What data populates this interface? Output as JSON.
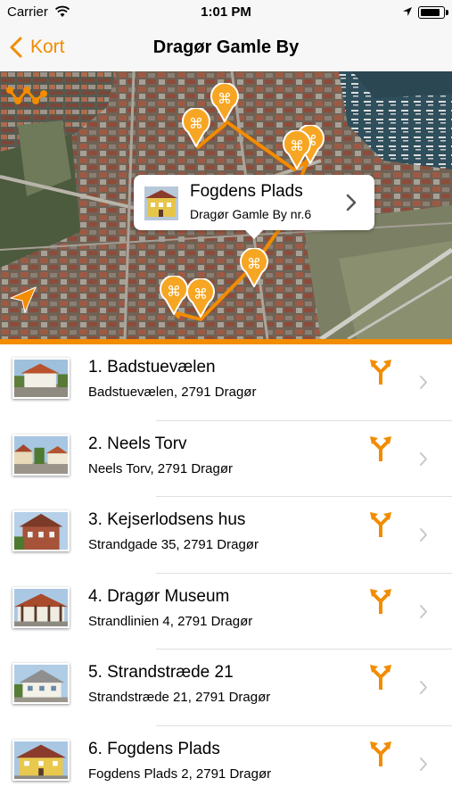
{
  "status_bar": {
    "carrier": "Carrier",
    "time": "1:01 PM",
    "battery_level": 0.9
  },
  "nav": {
    "back_label": "Kort",
    "title": "Dragør Gamle By"
  },
  "map": {
    "callout": {
      "title": "Fogdens Plads",
      "subtitle": "Dragør Gamle By nr.6"
    }
  },
  "colors": {
    "accent": "#f28c00",
    "pin": "#f6a623"
  },
  "places": [
    {
      "title": "1. Badstuevælen",
      "address": "Badstuevælen, 2791 Dragør"
    },
    {
      "title": "2. Neels Torv",
      "address": "Neels Torv, 2791 Dragør"
    },
    {
      "title": "3. Kejserlodsens hus",
      "address": "Strandgade 35, 2791 Dragør"
    },
    {
      "title": "4. Dragør Museum",
      "address": "Strandlinien 4, 2791 Dragør"
    },
    {
      "title": "5. Strandstræde 21",
      "address": "Strandstræde 21, 2791 Dragør"
    },
    {
      "title": "6. Fogdens Plads",
      "address": "Fogdens Plads 2, 2791 Dragør"
    }
  ]
}
